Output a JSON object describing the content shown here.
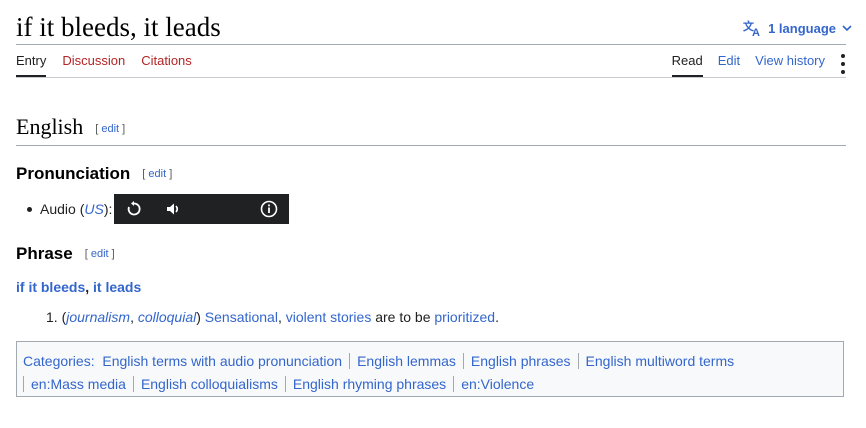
{
  "page": {
    "title": "if it bleeds, it leads",
    "language_button": "1 language"
  },
  "tabs": {
    "left": [
      "Entry",
      "Discussion",
      "Citations"
    ],
    "right": [
      "Read",
      "Edit",
      "View history"
    ]
  },
  "sections": {
    "english": {
      "heading": "English",
      "edit": "edit"
    },
    "pronunciation": {
      "heading": "Pronunciation",
      "edit": "edit",
      "audio_label": "Audio (",
      "audio_region": "US",
      "audio_close": "):"
    },
    "phrase": {
      "heading": "Phrase",
      "edit": "edit",
      "headword_part1": "if it bleeds",
      "headword_comma": ", ",
      "headword_part2": "it leads",
      "definition": {
        "number": "1.",
        "open": "(",
        "label1": "journalism",
        "label_sep": ", ",
        "label2": "colloquial",
        "close": ")",
        "sensational": "Sensational",
        "comma": ",",
        "violent_stories": "violent stories",
        "mid": "are to be",
        "prioritized": "prioritized",
        "period": "."
      }
    }
  },
  "categories": {
    "label": "Categories",
    "items": [
      "English terms with audio pronunciation",
      "English lemmas",
      "English phrases",
      "English multiword terms",
      "en:Mass media",
      "English colloquialisms",
      "English rhyming phrases",
      "en:Violence"
    ]
  },
  "icons": {
    "language": "translate-icon",
    "player": [
      "replay-icon",
      "volume-icon",
      "info-icon"
    ]
  },
  "colors": {
    "link": "#3366cc",
    "red_link": "#b32424",
    "text": "#202122",
    "player_bg": "#202122"
  }
}
